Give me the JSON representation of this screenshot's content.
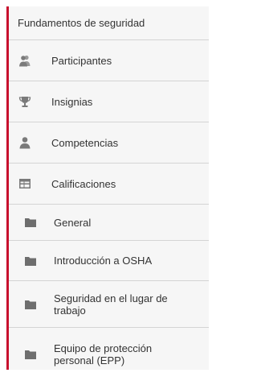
{
  "nav": {
    "course_title": "Fundamentos de seguridad",
    "items": [
      {
        "label": "Participantes",
        "icon": "users-icon"
      },
      {
        "label": "Insignias",
        "icon": "trophy-icon"
      },
      {
        "label": "Competencias",
        "icon": "user-icon"
      },
      {
        "label": "Calificaciones",
        "icon": "table-icon"
      }
    ],
    "sections": [
      {
        "label": "General",
        "icon": "folder-icon"
      },
      {
        "label": "Introducción a OSHA",
        "icon": "folder-icon"
      },
      {
        "label": "Seguridad en el lugar de trabajo",
        "icon": "folder-icon"
      },
      {
        "label": "Equipo de protección personal (EPP)",
        "icon": "folder-icon"
      }
    ]
  },
  "colors": {
    "accent": "#c8102e",
    "background": "#f6f6f6",
    "divider": "#d4d4d4",
    "icon": "#7a7a7a",
    "text": "#333333"
  }
}
